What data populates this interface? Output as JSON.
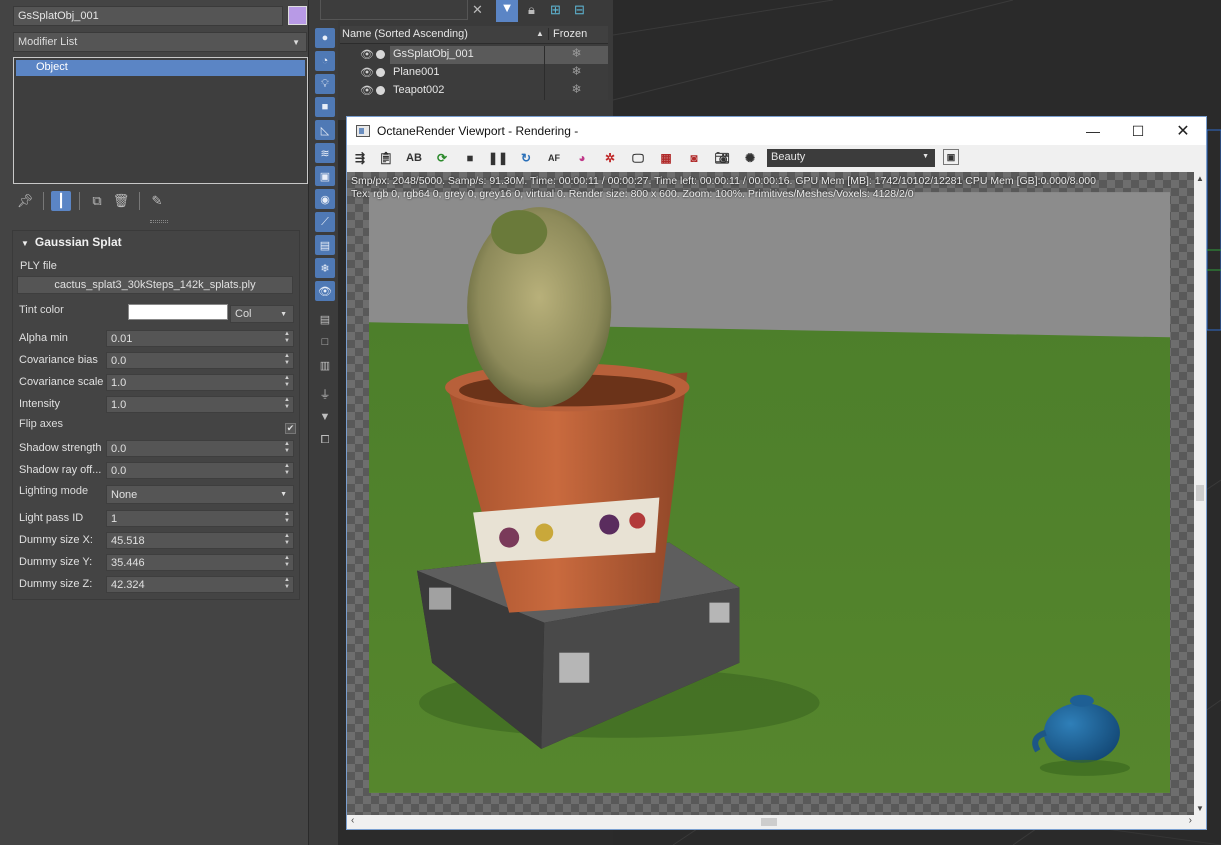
{
  "object": {
    "name": "GsSplatObj_001",
    "color": "#b89ae6"
  },
  "modifier": {
    "list_label": "Modifier List",
    "stack_item": "Object"
  },
  "rollout": {
    "title": "Gaussian Splat",
    "ply_label": "PLY file",
    "ply_file": "cactus_splat3_30kSteps_142k_splats.ply",
    "tint_label": "Tint color",
    "tint_value": "#ffffff",
    "tint_mode": "Col",
    "params": [
      {
        "label": "Alpha min",
        "value": "0.01"
      },
      {
        "label": "Covariance bias",
        "value": "0.0"
      },
      {
        "label": "Covariance scale",
        "value": "1.0"
      },
      {
        "label": "Intensity",
        "value": "1.0"
      }
    ],
    "flip_label": "Flip axes",
    "flip_checked": true,
    "params2": [
      {
        "label": "Shadow strength",
        "value": "0.0"
      },
      {
        "label": "Shadow ray off...",
        "value": "0.0"
      }
    ],
    "lighting_label": "Lighting mode",
    "lighting_value": "None",
    "params3": [
      {
        "label": "Light pass ID",
        "value": "1"
      },
      {
        "label": "Dummy size X:",
        "value": "45.518"
      },
      {
        "label": "Dummy size Y:",
        "value": "35.446"
      },
      {
        "label": "Dummy size Z:",
        "value": "42.324"
      }
    ]
  },
  "explorer": {
    "col_name": "Name (Sorted Ascending)",
    "col_frozen": "Frozen",
    "rows": [
      "GsSplatObj_001",
      "Plane001",
      "Teapot002"
    ]
  },
  "octane": {
    "title": "OctaneRender Viewport - Rendering -",
    "pass": "Beauty",
    "stats_line1": "Smp/px: 2048/5000.   Samp/s: 91.30M.   Time: 00:00:11 / 00:00:27.   Time left: 00:00:11 / 00:00:16.   GPU Mem [MB]: 1742/10102/12281   CPU Mem [GB]:0.000/8.000",
    "stats_line2": "Tex: rgb 0, rgb64 0, grey 0, grey16 0, virtual 0.   Render size: 800 x 600.   Zoom: 100%.   Primitives/Meshes/Voxels: 4128/2/0"
  }
}
